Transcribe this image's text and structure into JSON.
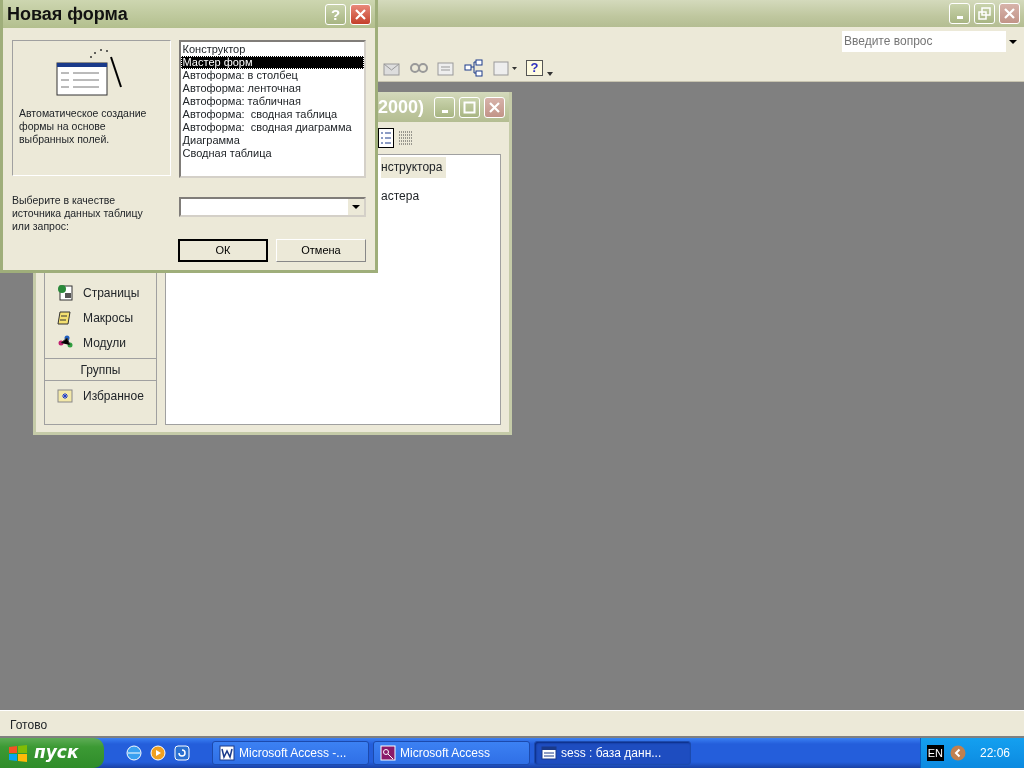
{
  "main_window": {
    "ask_placeholder": "Введите вопрос",
    "help_glyph": "?",
    "status": "Готово"
  },
  "db_window": {
    "title": "2000)",
    "objects": [
      {
        "label": "Страницы",
        "kind": "pages"
      },
      {
        "label": "Макросы",
        "kind": "macros"
      },
      {
        "label": "Модули",
        "kind": "modules"
      }
    ],
    "group_header": "Группы",
    "groups": [
      {
        "label": "Избранное"
      }
    ],
    "items": [
      {
        "label": "нструктора",
        "selected": true
      },
      {
        "label": "астера",
        "selected": false
      }
    ]
  },
  "dialog": {
    "title": "Новая форма",
    "help_glyph": "?",
    "description": "Автоматическое создание формы на основе выбранных полей.",
    "options": [
      {
        "label": "Конструктор",
        "selected": false
      },
      {
        "label": "Мастер форм",
        "selected": true
      },
      {
        "label": "Автоформа: в столбец",
        "selected": false
      },
      {
        "label": "Автоформа: ленточная",
        "selected": false
      },
      {
        "label": "Автоформа: табличная",
        "selected": false
      },
      {
        "label": "Автоформа:  сводная таблица",
        "selected": false
      },
      {
        "label": "Автоформа:  сводная диаграмма",
        "selected": false
      },
      {
        "label": "Диаграмма",
        "selected": false
      },
      {
        "label": "Сводная таблица",
        "selected": false
      }
    ],
    "source_label": "Выберите в качестве источника данных таблицу или запрос:",
    "buttons": [
      "ОК",
      "Отмена"
    ]
  },
  "taskbar": {
    "start": "пуск",
    "tasks": [
      {
        "label": "Microsoft Access -...",
        "selected": false,
        "kind": "word"
      },
      {
        "label": "Microsoft Access",
        "selected": false,
        "kind": "access"
      },
      {
        "label": "sess : база данн...",
        "selected": true,
        "kind": "db"
      }
    ],
    "lang": "EN",
    "clock": "22:06"
  }
}
